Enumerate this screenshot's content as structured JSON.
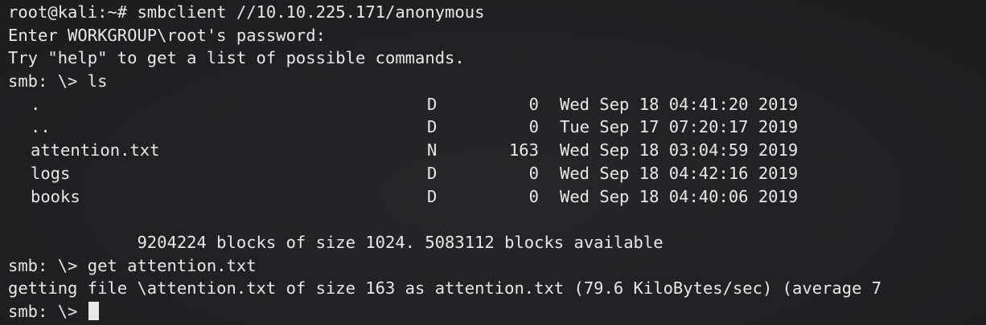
{
  "lines": {
    "l1": "root@kali:~# smbclient //10.10.225.171/anonymous",
    "l2": "Enter WORKGROUP\\root's password:",
    "l3": "Try \"help\" to get a list of possible commands.",
    "l4": "smb: \\> ls",
    "blocks": "             9204224 blocks of size 1024. 5083112 blocks available",
    "get_cmd": "smb: \\> get attention.txt",
    "getting": "getting file \\attention.txt of size 163 as attention.txt (79.6 KiloBytes/sec) (average 7",
    "prompt": "smb: \\> "
  },
  "listing": [
    {
      "name": ".",
      "attr": "D",
      "size": "0",
      "date": "Wed Sep 18 04:41:20 2019"
    },
    {
      "name": "..",
      "attr": "D",
      "size": "0",
      "date": "Tue Sep 17 07:20:17 2019"
    },
    {
      "name": "attention.txt",
      "attr": "N",
      "size": "163",
      "date": "Wed Sep 18 03:04:59 2019"
    },
    {
      "name": "logs",
      "attr": "D",
      "size": "0",
      "date": "Wed Sep 18 04:42:16 2019"
    },
    {
      "name": "books",
      "attr": "D",
      "size": "0",
      "date": "Wed Sep 18 04:40:06 2019"
    }
  ]
}
